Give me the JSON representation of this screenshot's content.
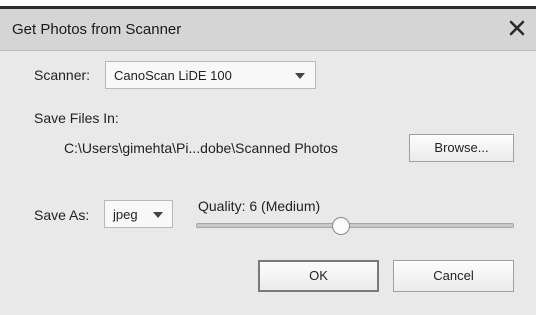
{
  "dialog": {
    "title": "Get Photos from Scanner",
    "close_icon": "close-icon"
  },
  "scanner": {
    "label": "Scanner:",
    "selected": "CanoScan LiDE 100"
  },
  "save_files": {
    "label": "Save Files In:",
    "path": "C:\\Users\\gimehta\\Pi...dobe\\Scanned Photos",
    "browse_label": "Browse..."
  },
  "save_as": {
    "label": "Save As:",
    "selected": "jpeg"
  },
  "quality": {
    "label": "Quality: 6 (Medium)",
    "value": 6,
    "min": 1,
    "max": 12
  },
  "buttons": {
    "ok": "OK",
    "cancel": "Cancel"
  },
  "colors": {
    "background": "#e9e9e9",
    "titlebar": "#d5d5d5"
  }
}
